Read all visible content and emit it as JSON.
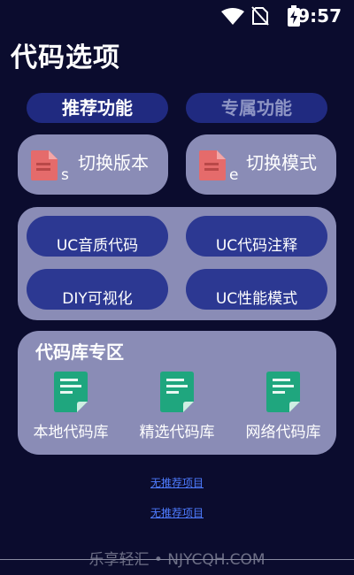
{
  "status_bar": {
    "time": "9:57"
  },
  "page": {
    "title": "代码选项"
  },
  "tabs": [
    {
      "label": "推荐功能"
    },
    {
      "label": "专属功能"
    }
  ],
  "switch_buttons": [
    {
      "label": "切换版本",
      "letter": "s"
    },
    {
      "label": "切换模式",
      "letter": "e"
    }
  ],
  "feature_pills": [
    {
      "label": "UC音质代码"
    },
    {
      "label": "UC代码注释"
    },
    {
      "label": "DIY可视化"
    },
    {
      "label": "UC性能模式"
    }
  ],
  "library": {
    "title": "代码库专区",
    "items": [
      {
        "label": "本地代码库"
      },
      {
        "label": "精选代码库"
      },
      {
        "label": "网络代码库"
      }
    ]
  },
  "links": [
    {
      "label": "无推荐项目"
    },
    {
      "label": "无推荐项目"
    }
  ],
  "watermark": "乐享轻汇 • NJYCQH.COM",
  "colors": {
    "background": "#0b0c2e",
    "card": "#8a8cb6",
    "tab_bg": "#202a80",
    "pill_bg": "#2c3892",
    "file_icon": "#e56b6b",
    "doc_icon": "#1fa67e",
    "link": "#4e7cff"
  }
}
